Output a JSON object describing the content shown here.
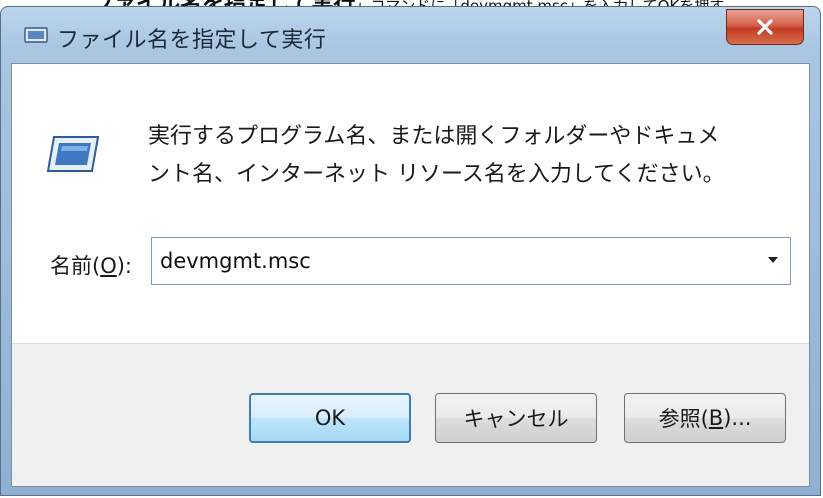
{
  "caption": {
    "part1": "ファイル名を指定して実行",
    "part2": "」コマンドに「devmgmt.msc」を入力してOKを押す"
  },
  "window": {
    "title": "ファイル名を指定して実行",
    "icon": "run-icon",
    "close_label": "X"
  },
  "dialog": {
    "description_line1": "実行するプログラム名、または開くフォルダーやドキュメ",
    "description_line2": "ント名、インターネット リソース名を入力してください。",
    "name_label_prefix": "名前(",
    "name_label_key": "O",
    "name_label_suffix": "):",
    "name_value": "devmgmt.msc",
    "dropdown_icon": "chevron-down-icon"
  },
  "buttons": {
    "ok": "OK",
    "cancel": "キャンセル",
    "browse_prefix": "参照(",
    "browse_key": "B",
    "browse_suffix": ")..."
  },
  "colors": {
    "titlebar": "#a9c6e3",
    "close_button": "#c13b22",
    "default_button_border": "#3c7fb1"
  }
}
